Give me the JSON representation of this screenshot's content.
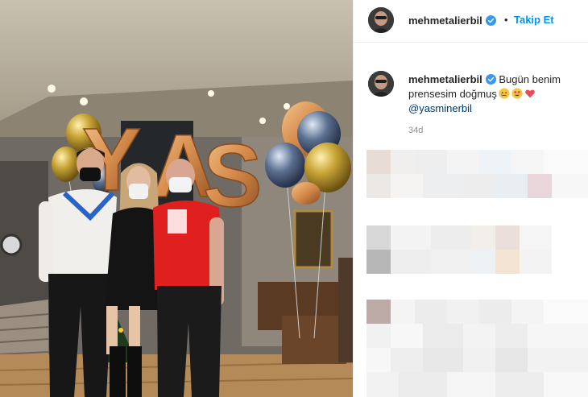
{
  "post": {
    "username": "mehmetalierbil",
    "follow_label": "Takip Et",
    "separator": "•",
    "caption_text": "Bugün benim prensesim doğmuş",
    "mention": "@yasminerbil",
    "time_ago": "34d",
    "balloon_letters": [
      "Y",
      "A",
      "S"
    ],
    "icons": {
      "verified": "verified-badge-icon",
      "emojis": [
        "crying-face-emoji-icon",
        "heart-eyes-emoji-icon",
        "red-heart-icon"
      ]
    },
    "colors": {
      "accent": "#0095f6",
      "mention": "#00376b",
      "verified": "#3897f0",
      "heart": "#ed4956"
    }
  }
}
